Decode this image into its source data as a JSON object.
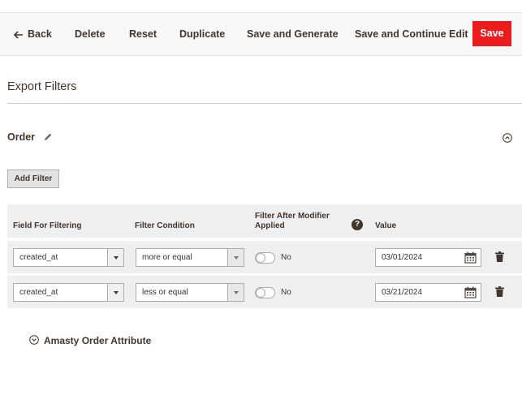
{
  "toolbar": {
    "back_label": "Back",
    "delete_label": "Delete",
    "reset_label": "Reset",
    "duplicate_label": "Duplicate",
    "save_generate_label": "Save and Generate",
    "save_continue_label": "Save and Continue Edit",
    "save_label": "Save"
  },
  "section": {
    "title": "Export Filters"
  },
  "order": {
    "title": "Order",
    "add_filter_label": "Add Filter"
  },
  "table": {
    "headers": {
      "field": "Field For Filtering",
      "condition": "Filter Condition",
      "after_modifier": "Filter After Modifier Applied",
      "help": "?",
      "value": "Value"
    },
    "rows": [
      {
        "field": "created_at",
        "condition": "more or equal",
        "after_modifier": "No",
        "value": "03/01/2024"
      },
      {
        "field": "created_at",
        "condition": "less or equal",
        "after_modifier": "No",
        "value": "03/21/2024"
      }
    ]
  },
  "amasty": {
    "label": "Amasty Order Attribute"
  },
  "colors": {
    "accent": "#ed1c1c",
    "text": "#41362f",
    "row_bg": "#efefef"
  },
  "icons": [
    "back-arrow-icon",
    "pencil-icon",
    "collapse-up-icon",
    "help-icon",
    "calendar-icon",
    "trash-icon",
    "expand-down-icon"
  ]
}
